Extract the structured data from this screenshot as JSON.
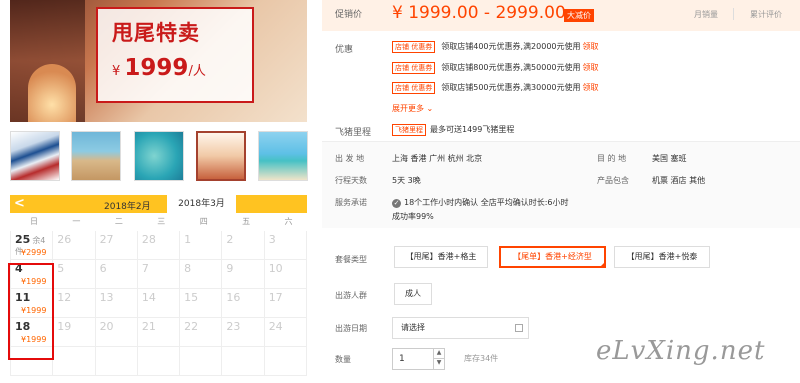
{
  "hero": {
    "title": "甩尾特卖",
    "price_prefix": "¥",
    "price": "1999",
    "price_suffix": "/人"
  },
  "thumbnails": [
    "flag-icon",
    "beach-icon",
    "snorkel-icon",
    "promo-icon",
    "beach-icon"
  ],
  "calendar": {
    "prev_label": "<",
    "month_prev": "2018年2月",
    "month_current": "2018年3月",
    "weekdays": [
      "日",
      "一",
      "二",
      "三",
      "四",
      "五",
      "六"
    ],
    "rows": [
      [
        {
          "d": "25",
          "n": "余4件",
          "p": "¥2999",
          "active": true
        },
        {
          "d": "26"
        },
        {
          "d": "27"
        },
        {
          "d": "28"
        },
        {
          "d": "1"
        },
        {
          "d": "2"
        },
        {
          "d": "3"
        }
      ],
      [
        {
          "d": "4",
          "p": "¥1999",
          "active": true
        },
        {
          "d": "5"
        },
        {
          "d": "6"
        },
        {
          "d": "7"
        },
        {
          "d": "8"
        },
        {
          "d": "9"
        },
        {
          "d": "10"
        }
      ],
      [
        {
          "d": "11",
          "p": "¥1999",
          "active": true
        },
        {
          "d": "12"
        },
        {
          "d": "13"
        },
        {
          "d": "14"
        },
        {
          "d": "15"
        },
        {
          "d": "16"
        },
        {
          "d": "17"
        }
      ],
      [
        {
          "d": "18",
          "p": "¥1999",
          "active": true
        },
        {
          "d": "19"
        },
        {
          "d": "20"
        },
        {
          "d": "21"
        },
        {
          "d": "22"
        },
        {
          "d": "23"
        },
        {
          "d": "24"
        }
      ],
      [
        {
          "d": ""
        },
        {
          "d": ""
        },
        {
          "d": ""
        },
        {
          "d": ""
        },
        {
          "d": ""
        },
        {
          "d": ""
        },
        {
          "d": ""
        }
      ]
    ]
  },
  "price_bar": {
    "label": "促销价",
    "value": "¥ 1999.00 - 2999.00",
    "badge": "大减价",
    "monthly_sales": "月销量",
    "reviews": "累计评价"
  },
  "coupons": {
    "label": "优惠",
    "items": [
      {
        "tag": "店铺 优惠券",
        "text": "领取店铺400元优惠券,满20000元使用",
        "action": "领取"
      },
      {
        "tag": "店铺 优惠券",
        "text": "领取店铺800元优惠券,满50000元使用",
        "action": "领取"
      },
      {
        "tag": "店铺 优惠券",
        "text": "领取店铺500元优惠券,满30000元使用",
        "action": "领取"
      }
    ],
    "more": "展开更多 ⌄"
  },
  "miles": {
    "label": "飞猪里程",
    "tag": "飞猪里程",
    "text": "最多可送1499飞猪里程"
  },
  "info": {
    "departure_label": "出 发 地",
    "departure": "上海   香港   广州   杭州   北京",
    "destination_label": "目 的 地",
    "destination": "美国   塞班",
    "days_label": "行程天数",
    "days": "5天   3晚",
    "includes_label": "产品包含",
    "includes": "机票   酒店   其他",
    "promise_label": "服务承诺",
    "promise_line1": "18个工作小时内确认 全店平均确认时长:6小时",
    "promise_line2": "成功率99%"
  },
  "package": {
    "label": "套餐类型",
    "options": [
      "【甩尾】香港+格主",
      "【尾单】香港+经济型",
      "【甩尾】香港+悦泰"
    ]
  },
  "travelers": {
    "label": "出游人群",
    "option": "成人"
  },
  "date": {
    "label": "出游日期",
    "placeholder": "请选择"
  },
  "quantity": {
    "label": "数量",
    "value": "1",
    "stock": "库存34件"
  },
  "watermark": "eLvXing.net",
  "colors": {
    "accent": "#ff4400",
    "calendar_header": "#ffc321",
    "highlight_box": "#e40b0b"
  }
}
